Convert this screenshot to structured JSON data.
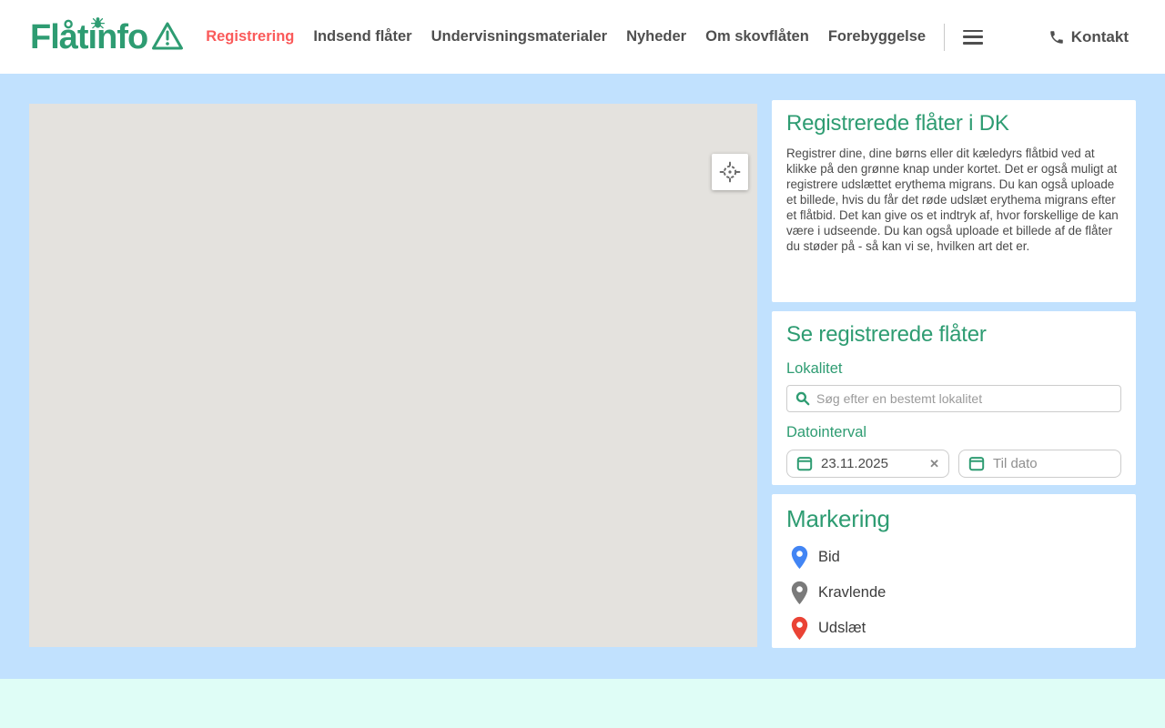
{
  "header": {
    "logo_text": "Flåtinfo",
    "nav": [
      {
        "label": "Registrering"
      },
      {
        "label": "Indsend flåter"
      },
      {
        "label": "Undervisningsmaterialer"
      },
      {
        "label": "Nyheder"
      },
      {
        "label": "Om skovflåten"
      },
      {
        "label": "Forebyggelse"
      }
    ],
    "contact_label": "Kontakt"
  },
  "panels": {
    "registered": {
      "title": "Registrerede flåter i DK",
      "body": "Registrer dine, dine børns eller dit kæledyrs flåtbid ved at klikke på den grønne knap under kortet. Det er også muligt at registrere udslættet erythema migrans. Du kan også uploade et billede, hvis du får det røde udslæt erythema migrans efter et flåtbid. Det kan give os et indtryk af, hvor forskellige de kan være i udseende. Du kan også uploade et billede af de flåter du støder på - så kan vi se, hvilken art det er."
    },
    "filter": {
      "title": "Se registrerede flåter",
      "locality_label": "Lokalitet",
      "locality_placeholder": "Søg efter en bestemt lokalitet",
      "date_label": "Datointerval",
      "date_from_value": "23.11.2025",
      "date_to_placeholder": "Til dato",
      "clear_glyph": "✕"
    },
    "legend": {
      "title": "Markering",
      "items": [
        {
          "label": "Bid",
          "color": "#4285F4"
        },
        {
          "label": "Kravlende",
          "color": "#7A7A7A"
        },
        {
          "label": "Udslæt",
          "color": "#EA4335"
        }
      ]
    }
  },
  "colors": {
    "brand_green": "#2E9C72",
    "active_red": "#FA5A5A",
    "page_background": "#C1E1FE",
    "footer_background": "#DFFDF6",
    "map_background": "#E4E2DE"
  }
}
